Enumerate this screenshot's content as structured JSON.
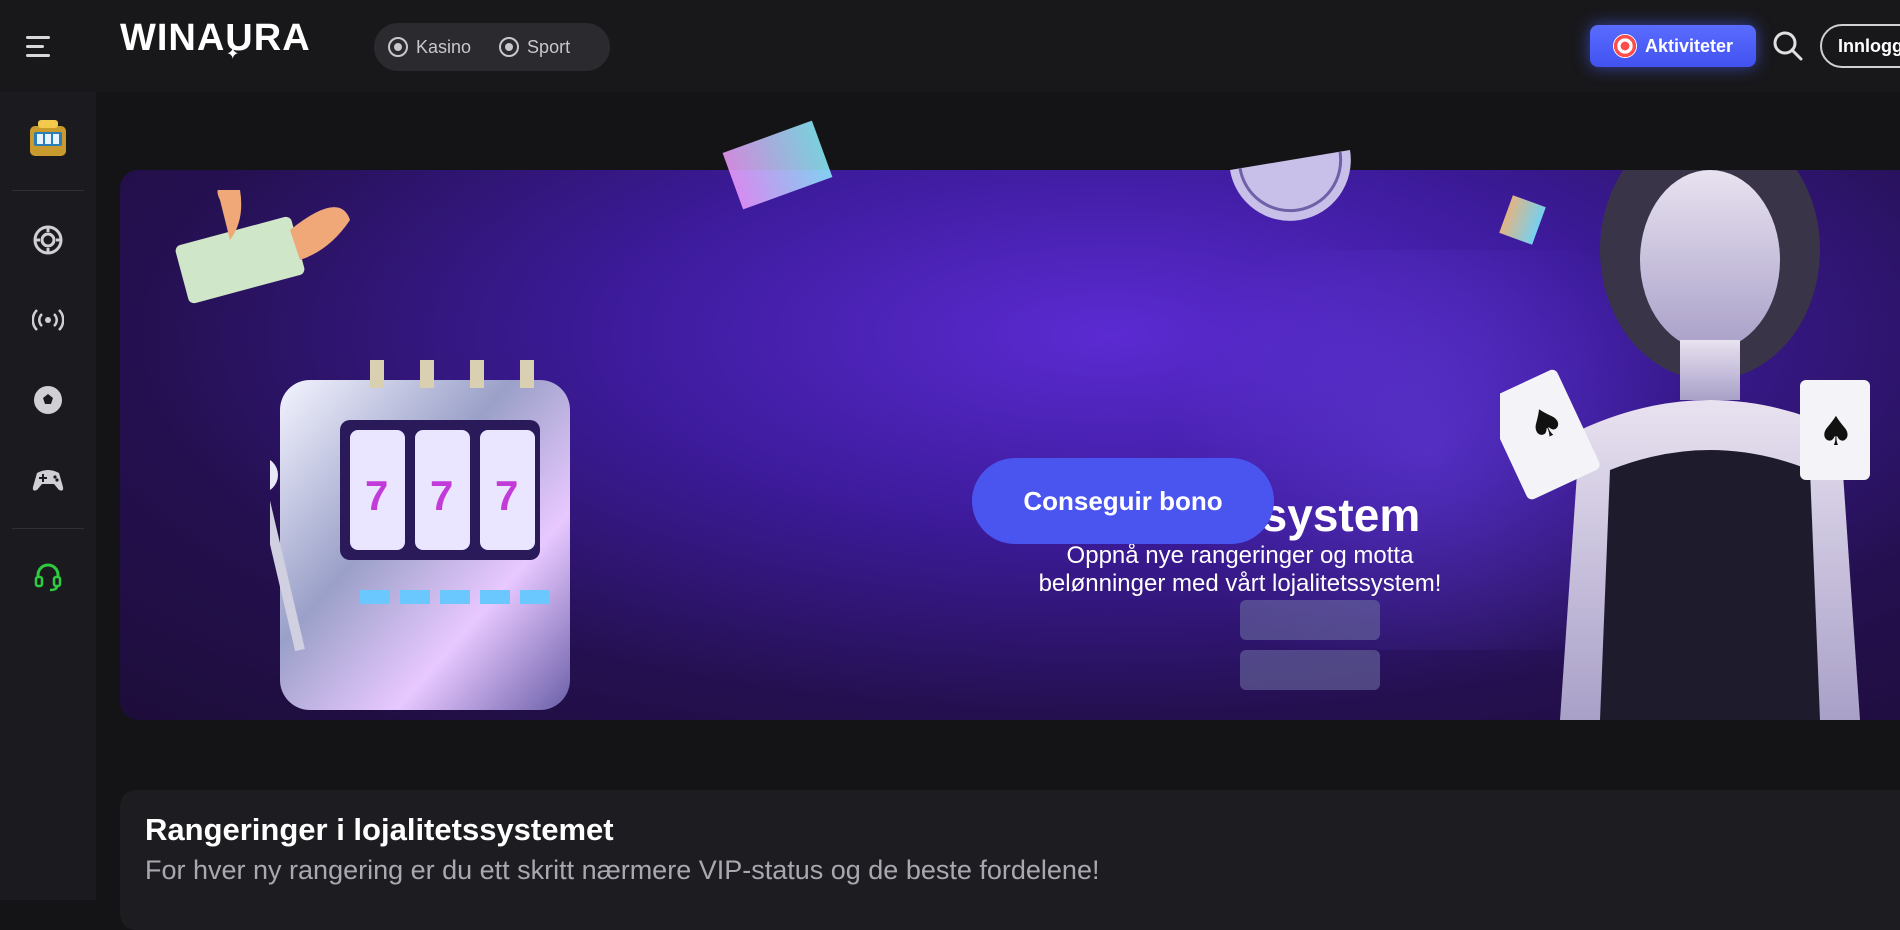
{
  "header": {
    "logo": "WINAURA",
    "nav": [
      {
        "label": "Kasino",
        "icon": "casino-chip-icon"
      },
      {
        "label": "Sport",
        "icon": "football-icon"
      }
    ],
    "activities_label": "Aktiviteter",
    "login_label": "Innlogg"
  },
  "sidebar": {
    "items": [
      {
        "icon": "slot-machine-icon"
      },
      {
        "icon": "casino-chip-icon"
      },
      {
        "icon": "live-broadcast-icon"
      },
      {
        "icon": "football-icon"
      },
      {
        "icon": "gamepad-icon"
      },
      {
        "icon": "headset-support-icon"
      }
    ]
  },
  "banner": {
    "title": "Lojalitetssystem",
    "subtitle_line1": "Oppnå nye rangeringer og motta",
    "subtitle_line2": "belønninger med vårt lojalitetssystem!",
    "cta_label": "Conseguir bono"
  },
  "ranks": {
    "title": "Rangeringer i lojalitetssystemet",
    "subtitle": "For hver ny rangering er du ett skritt nærmere VIP-status og de beste fordelene!"
  },
  "colors": {
    "accent": "#4a55f0",
    "background": "#141416",
    "support_green": "#2ecc40"
  }
}
